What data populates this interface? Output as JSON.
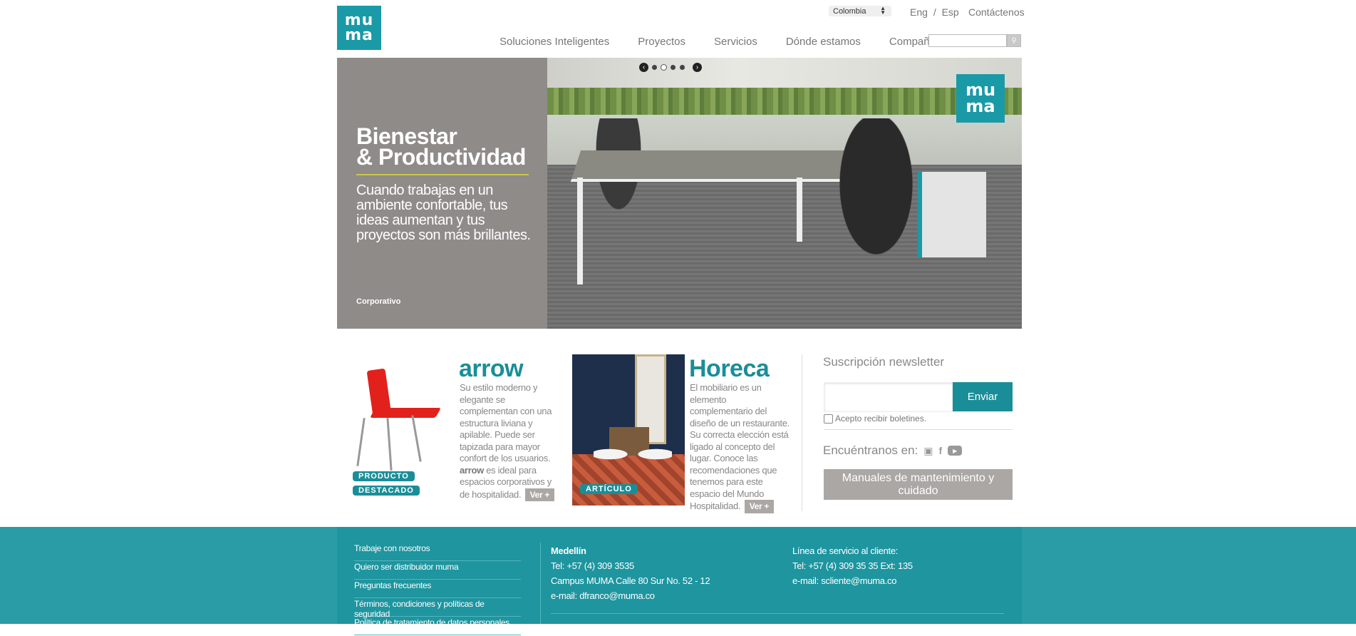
{
  "header": {
    "logo_top": "mu",
    "logo_bottom": "ma",
    "country": "Colombia",
    "lang_en": "Eng",
    "lang_sep": "/",
    "lang_es": "Esp",
    "contact": "Contáctenos",
    "search_placeholder": ""
  },
  "nav": {
    "items": [
      "Soluciones Inteligentes",
      "Proyectos",
      "Servicios",
      "Dónde estamos",
      "Compañía"
    ]
  },
  "hero": {
    "title_line1": "Bienestar",
    "title_line2": "& Productividad",
    "description": "Cuando trabajas en un ambiente confortable, tus ideas aumentan y tus proyectos son más brillantes.",
    "category": "Corporativo",
    "logo_top": "mu",
    "logo_bottom": "ma",
    "slides": 4,
    "active_slide": 2
  },
  "featured_product": {
    "badge_line1": "PRODUCTO",
    "badge_line2": "DESTACADO",
    "title": "arrow",
    "desc_before": "Su estilo moderno y elegante se complementan con una estructura liviana y apilable. Puede ser tapizada para mayor confort de los usuarios.",
    "desc_bold": "arrow",
    "desc_after": "es ideal para espacios corporativos y de hospitalidad.",
    "more": "Ver +"
  },
  "article": {
    "badge": "ARTÍCULO",
    "title": "Horeca",
    "description": "El mobiliario es un elemento complementario del diseño de un restaurante. Su correcta elección está ligado al concepto del lugar. Conoce las recomendaciones que tenemos para este espacio del Mundo Hospitalidad.",
    "more": "Ver +"
  },
  "newsletter": {
    "title": "Suscripción newsletter",
    "input_value": "",
    "submit": "Enviar",
    "checkbox_label": "Acepto recibir boletines.",
    "social_label": "Encuéntranos en:",
    "manuals": "Manuales de mantenimiento y cuidado"
  },
  "footer": {
    "links": [
      "Trabaje con nosotros",
      "Quiero ser distribuidor muma",
      "Preguntas frecuentes",
      "Términos, condiciones y políticas de seguridad",
      "Política de tratamiento de datos personales"
    ],
    "office_city": "Medellín",
    "office_tel": "Tel: +57 (4) 309 3535",
    "office_address": "Campus MUMA Calle 80 Sur No. 52 - 12",
    "office_email": "e-mail: dfranco@muma.co",
    "service_title": "Línea de servicio al cliente:",
    "service_tel": "Tel: +57 (4) 309 35 35 Ext: 135",
    "service_email": "e-mail: scliente@muma.co"
  },
  "colors": {
    "brand": "#1a9aa6",
    "footer": "#1e959f",
    "hero_panel": "#8f8b89",
    "button_gray": "#aaa7a5"
  }
}
